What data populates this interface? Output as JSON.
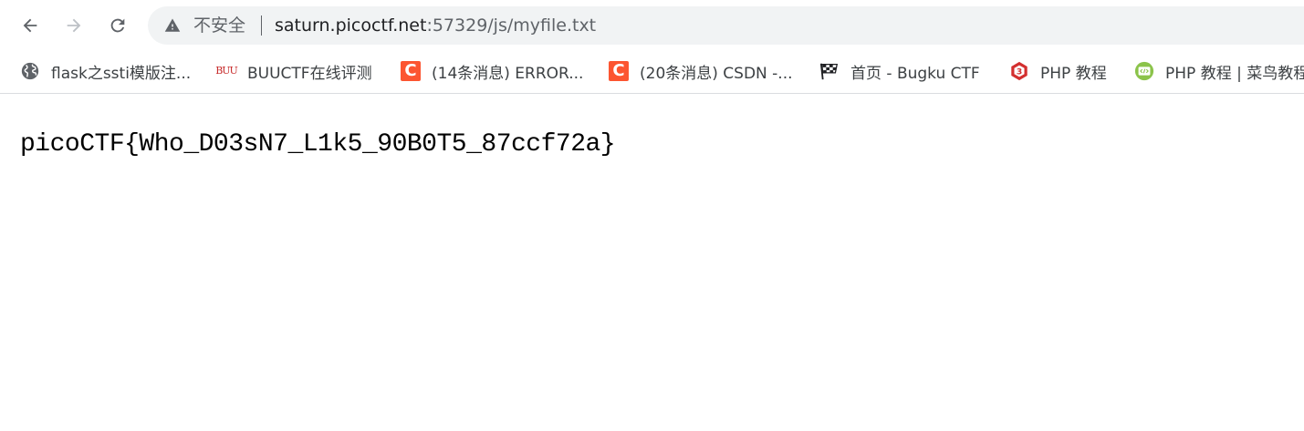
{
  "browser": {
    "security_label": "不安全",
    "url_host": "saturn.picoctf.net",
    "url_rest": ":57329/js/myfile.txt"
  },
  "bookmarks": [
    {
      "icon": "globe-icon",
      "label": "flask之ssti模版注..."
    },
    {
      "icon": "buuctf-icon",
      "icon_text": "BUU",
      "label": "BUUCTF在线评测"
    },
    {
      "icon": "csdn-icon",
      "icon_text": "C",
      "label": "(14条消息) ERROR..."
    },
    {
      "icon": "csdn-icon",
      "icon_text": "C",
      "label": "(20条消息) CSDN -..."
    },
    {
      "icon": "checkered-flag-icon",
      "label": "首页 - Bugku CTF"
    },
    {
      "icon": "php-logo-icon",
      "label": "PHP 教程"
    },
    {
      "icon": "runoob-icon",
      "label": "PHP 教程 | 菜鸟教程"
    }
  ],
  "page": {
    "text": "picoCTF{Who_D03sN7_L1k5_90B0T5_87ccf72a}"
  },
  "colors": {
    "csdn": "#fc5531",
    "buuctf": "#c62828",
    "php": "#d32f2f",
    "runoob": "#8bc34a"
  }
}
